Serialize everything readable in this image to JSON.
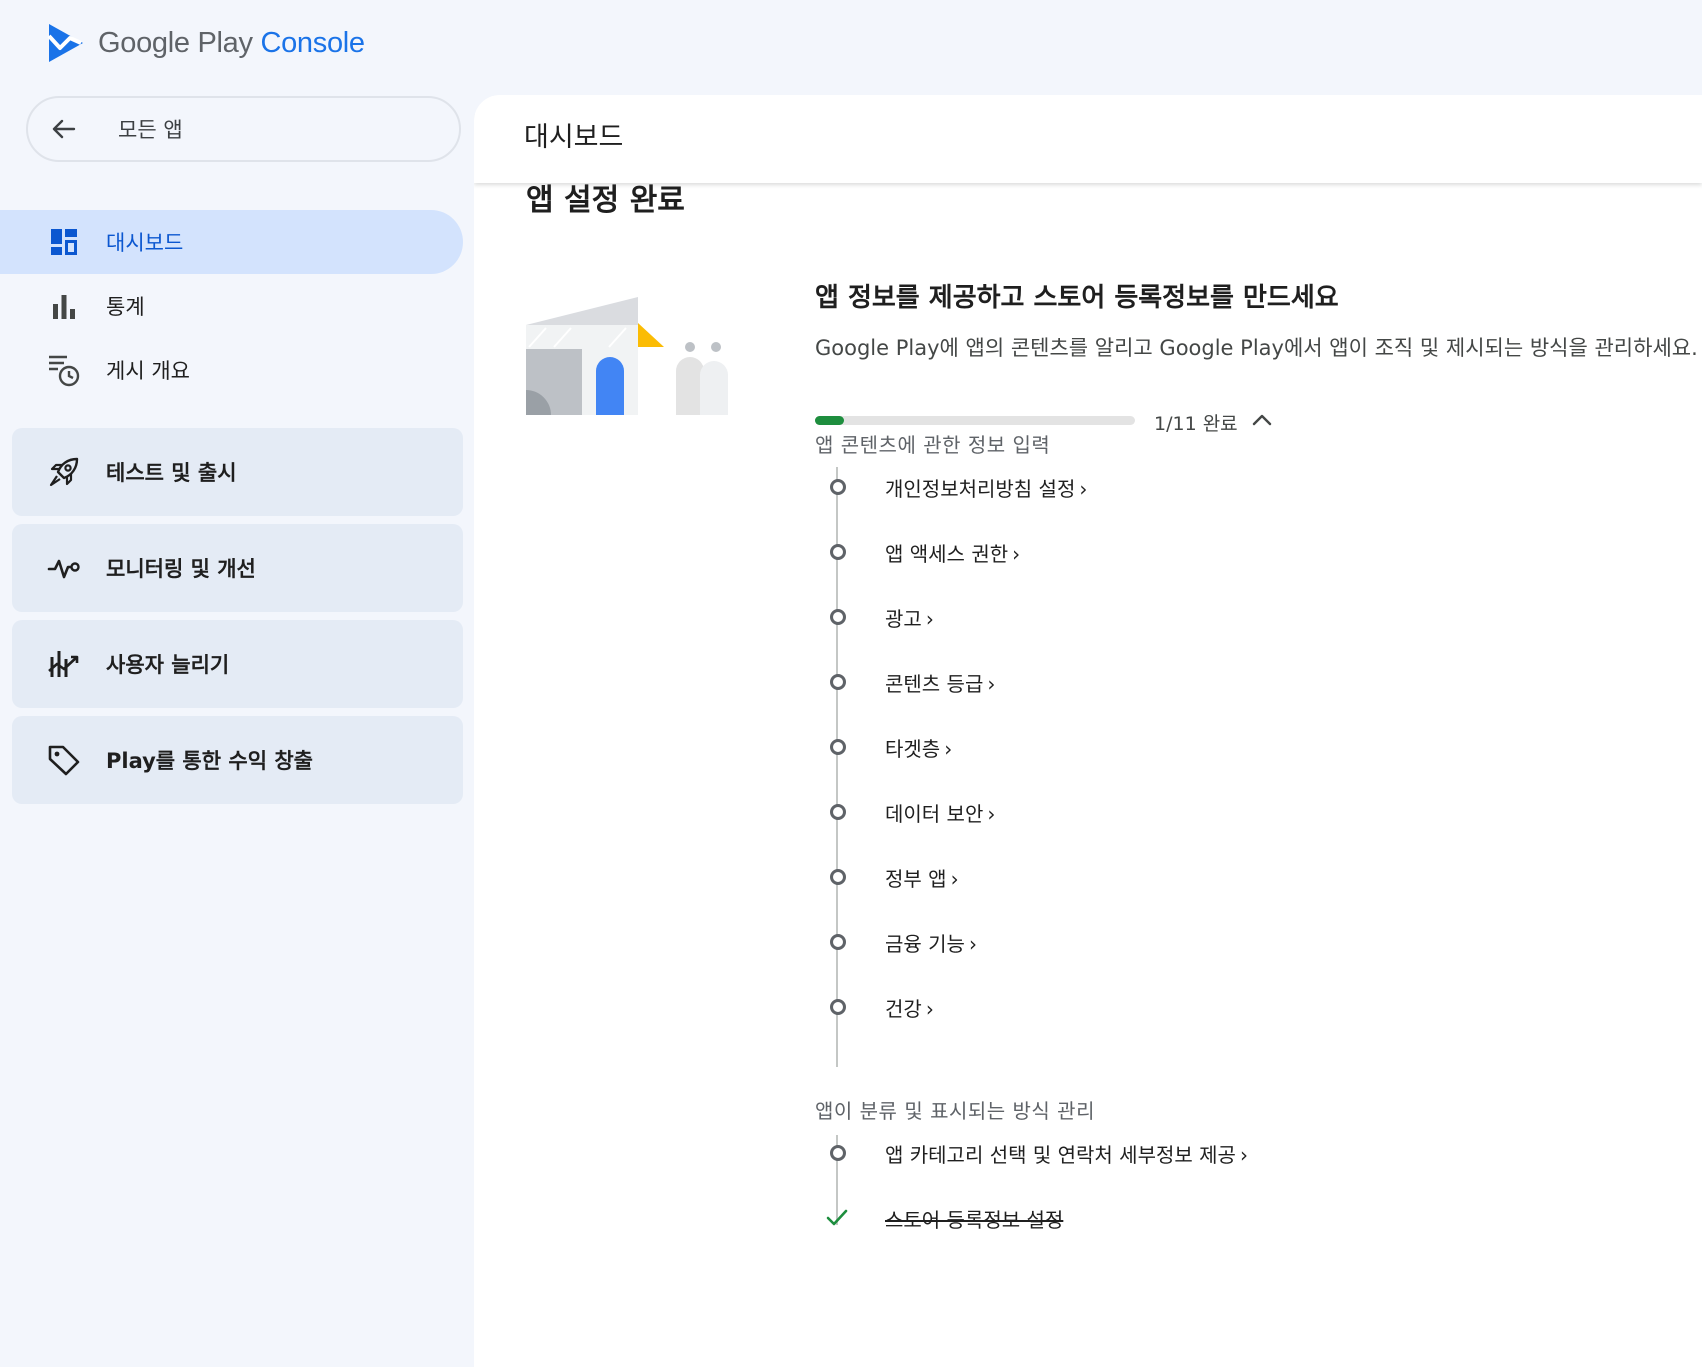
{
  "brand": {
    "name_main": "Google Play",
    "name_accent": "Console",
    "accent_color": "#1a73e8",
    "logo_icon": "play-console-logo-icon"
  },
  "sidebar": {
    "back_label": "모든 앱",
    "items": [
      {
        "label": "대시보드",
        "icon": "dashboard-icon",
        "active": true
      },
      {
        "label": "통계",
        "icon": "bar-chart-icon"
      },
      {
        "label": "게시 개요",
        "icon": "publishing-overview-icon"
      }
    ],
    "groups": [
      {
        "label": "테스트 및 출시",
        "icon": "rocket-icon"
      },
      {
        "label": "모니터링 및 개선",
        "icon": "vitals-icon"
      },
      {
        "label": "사용자 늘리기",
        "icon": "grow-users-icon"
      },
      {
        "label": "Play를 통한 수익 창출",
        "icon": "tag-icon"
      }
    ]
  },
  "main": {
    "page_title": "대시보드",
    "section_title": "앱 설정 완료",
    "card": {
      "title": "앱 정보를 제공하고 스토어 등록정보를 만드세요",
      "description": "Google Play에 앱의 콘텐츠를 알리고 Google Play에서 앱이 조직 및 제시되는 방식을 관리하세요.",
      "progress": {
        "completed": 1,
        "total": 11,
        "label": "1/11 완료",
        "color": "#1e8e3e"
      },
      "sections": [
        {
          "heading": "앱 콘텐츠에 관한 정보 입력",
          "tasks": [
            {
              "label": "개인정보처리방침 설정",
              "done": false
            },
            {
              "label": "앱 액세스 권한",
              "done": false
            },
            {
              "label": "광고",
              "done": false
            },
            {
              "label": "콘텐츠 등급",
              "done": false
            },
            {
              "label": "타겟층",
              "done": false
            },
            {
              "label": "데이터 보안",
              "done": false
            },
            {
              "label": "정부 앱",
              "done": false
            },
            {
              "label": "금융 기능",
              "done": false
            },
            {
              "label": "건강",
              "done": false
            }
          ]
        },
        {
          "heading": "앱이 분류 및 표시되는 방식 관리",
          "tasks": [
            {
              "label": "앱 카테고리 선택 및 연락처 세부정보 제공",
              "done": false
            },
            {
              "label": "스토어 등록정보 설정",
              "done": true
            }
          ]
        }
      ]
    }
  },
  "chevron": "›"
}
